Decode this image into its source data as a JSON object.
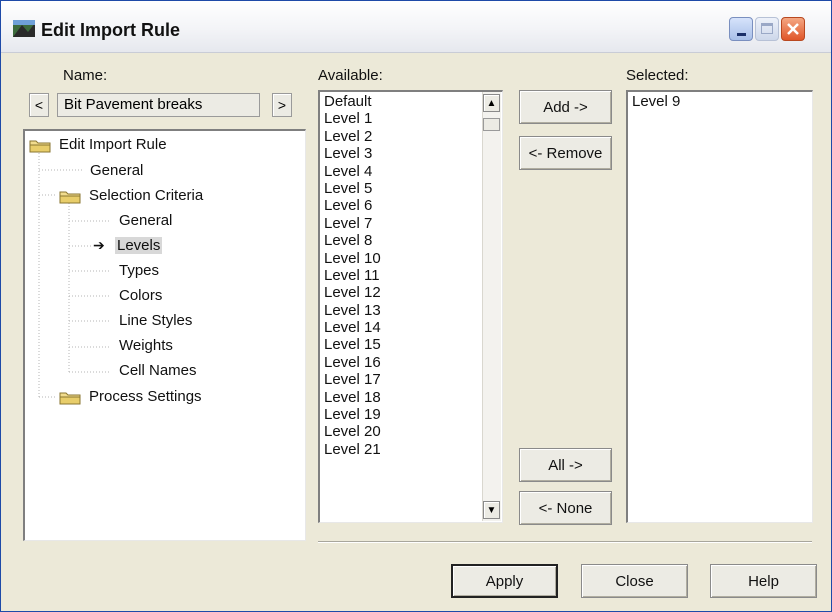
{
  "window": {
    "title": "Edit Import Rule"
  },
  "name_field": {
    "label": "Name:",
    "value": "Bit Pavement breaks",
    "prev": "<",
    "next": ">"
  },
  "tree": {
    "items": [
      {
        "label": "Edit Import Rule"
      },
      {
        "label": "General"
      },
      {
        "label": "Selection Criteria"
      },
      {
        "label": "General"
      },
      {
        "label": "Levels"
      },
      {
        "label": "Types"
      },
      {
        "label": "Colors"
      },
      {
        "label": "Line Styles"
      },
      {
        "label": "Weights"
      },
      {
        "label": "Cell Names"
      },
      {
        "label": "Process Settings"
      }
    ]
  },
  "available": {
    "label": "Available:",
    "items": [
      "Default",
      "Level 1",
      "Level 2",
      "Level 3",
      "Level 4",
      "Level 5",
      "Level 6",
      "Level 7",
      "Level 8",
      "Level 10",
      "Level 11",
      "Level 12",
      "Level 13",
      "Level 14",
      "Level 15",
      "Level 16",
      "Level 17",
      "Level 18",
      "Level 19",
      "Level 20",
      "Level 21"
    ]
  },
  "selected": {
    "label": "Selected:",
    "items": [
      "Level 9"
    ]
  },
  "buttons": {
    "add": "Add ->",
    "remove": "<- Remove",
    "all": "All ->",
    "none": "<- None",
    "apply": "Apply",
    "close": "Close",
    "help": "Help"
  },
  "icons": {
    "app": "app-icon",
    "folder": "folder-icon",
    "current": "arrow-right-icon",
    "scroll_up": "scroll-up-icon",
    "scroll_down": "scroll-down-icon"
  },
  "colors": {
    "face": "#ece9d8",
    "close_button": "#e0562a",
    "tree_selection": "#d8d8d8"
  }
}
